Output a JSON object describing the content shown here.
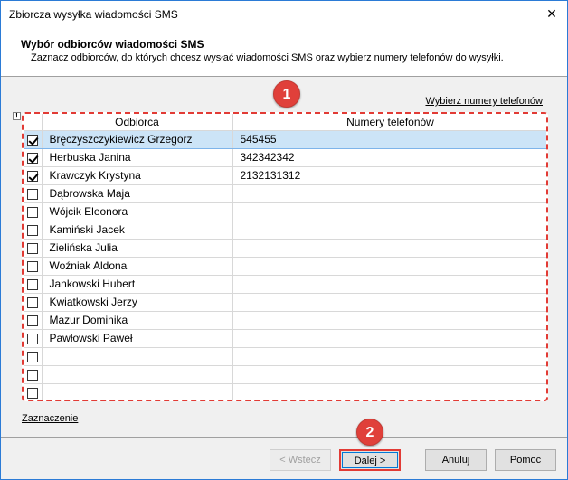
{
  "window": {
    "title": "Zbiorcza wysyłka wiadomości SMS",
    "close_glyph": "✕"
  },
  "header": {
    "title": "Wybór odbiorców wiadomości SMS",
    "description": "Zaznacz odbiorców, do których chcesz wysłać wiadomości SMS oraz wybierz numery telefonów do wysyłki."
  },
  "links": {
    "choose_phones": "Wybierz numery telefonów",
    "selection": "Zaznaczenie"
  },
  "badges": {
    "one": "1",
    "two": "2"
  },
  "grid": {
    "indicator": "!",
    "columns": {
      "recipient": "Odbiorca",
      "phones": "Numery telefonów"
    },
    "rows": [
      {
        "checked": true,
        "name": "Bręczyszczykiewicz Grzegorz",
        "phone": "545455",
        "selected": true
      },
      {
        "checked": true,
        "name": "Herbuska Janina",
        "phone": "342342342",
        "selected": false
      },
      {
        "checked": true,
        "name": "Krawczyk Krystyna",
        "phone": "2132131312",
        "selected": false
      },
      {
        "checked": false,
        "name": "Dąbrowska Maja",
        "phone": "",
        "selected": false
      },
      {
        "checked": false,
        "name": "Wójcik Eleonora",
        "phone": "",
        "selected": false
      },
      {
        "checked": false,
        "name": "Kamiński Jacek",
        "phone": "",
        "selected": false
      },
      {
        "checked": false,
        "name": "Zielińska Julia",
        "phone": "",
        "selected": false
      },
      {
        "checked": false,
        "name": "Woźniak Aldona",
        "phone": "",
        "selected": false
      },
      {
        "checked": false,
        "name": "Jankowski Hubert",
        "phone": "",
        "selected": false
      },
      {
        "checked": false,
        "name": "Kwiatkowski Jerzy",
        "phone": "",
        "selected": false
      },
      {
        "checked": false,
        "name": "Mazur Dominika",
        "phone": "",
        "selected": false
      },
      {
        "checked": false,
        "name": "Pawłowski Paweł",
        "phone": "",
        "selected": false
      },
      {
        "checked": false,
        "name": "",
        "phone": "",
        "selected": false
      },
      {
        "checked": false,
        "name": "",
        "phone": "",
        "selected": false
      },
      {
        "checked": false,
        "name": "",
        "phone": "",
        "selected": false
      }
    ]
  },
  "buttons": {
    "back": "< Wstecz",
    "next": "Dalej >",
    "cancel": "Anuluj",
    "help": "Pomoc"
  }
}
